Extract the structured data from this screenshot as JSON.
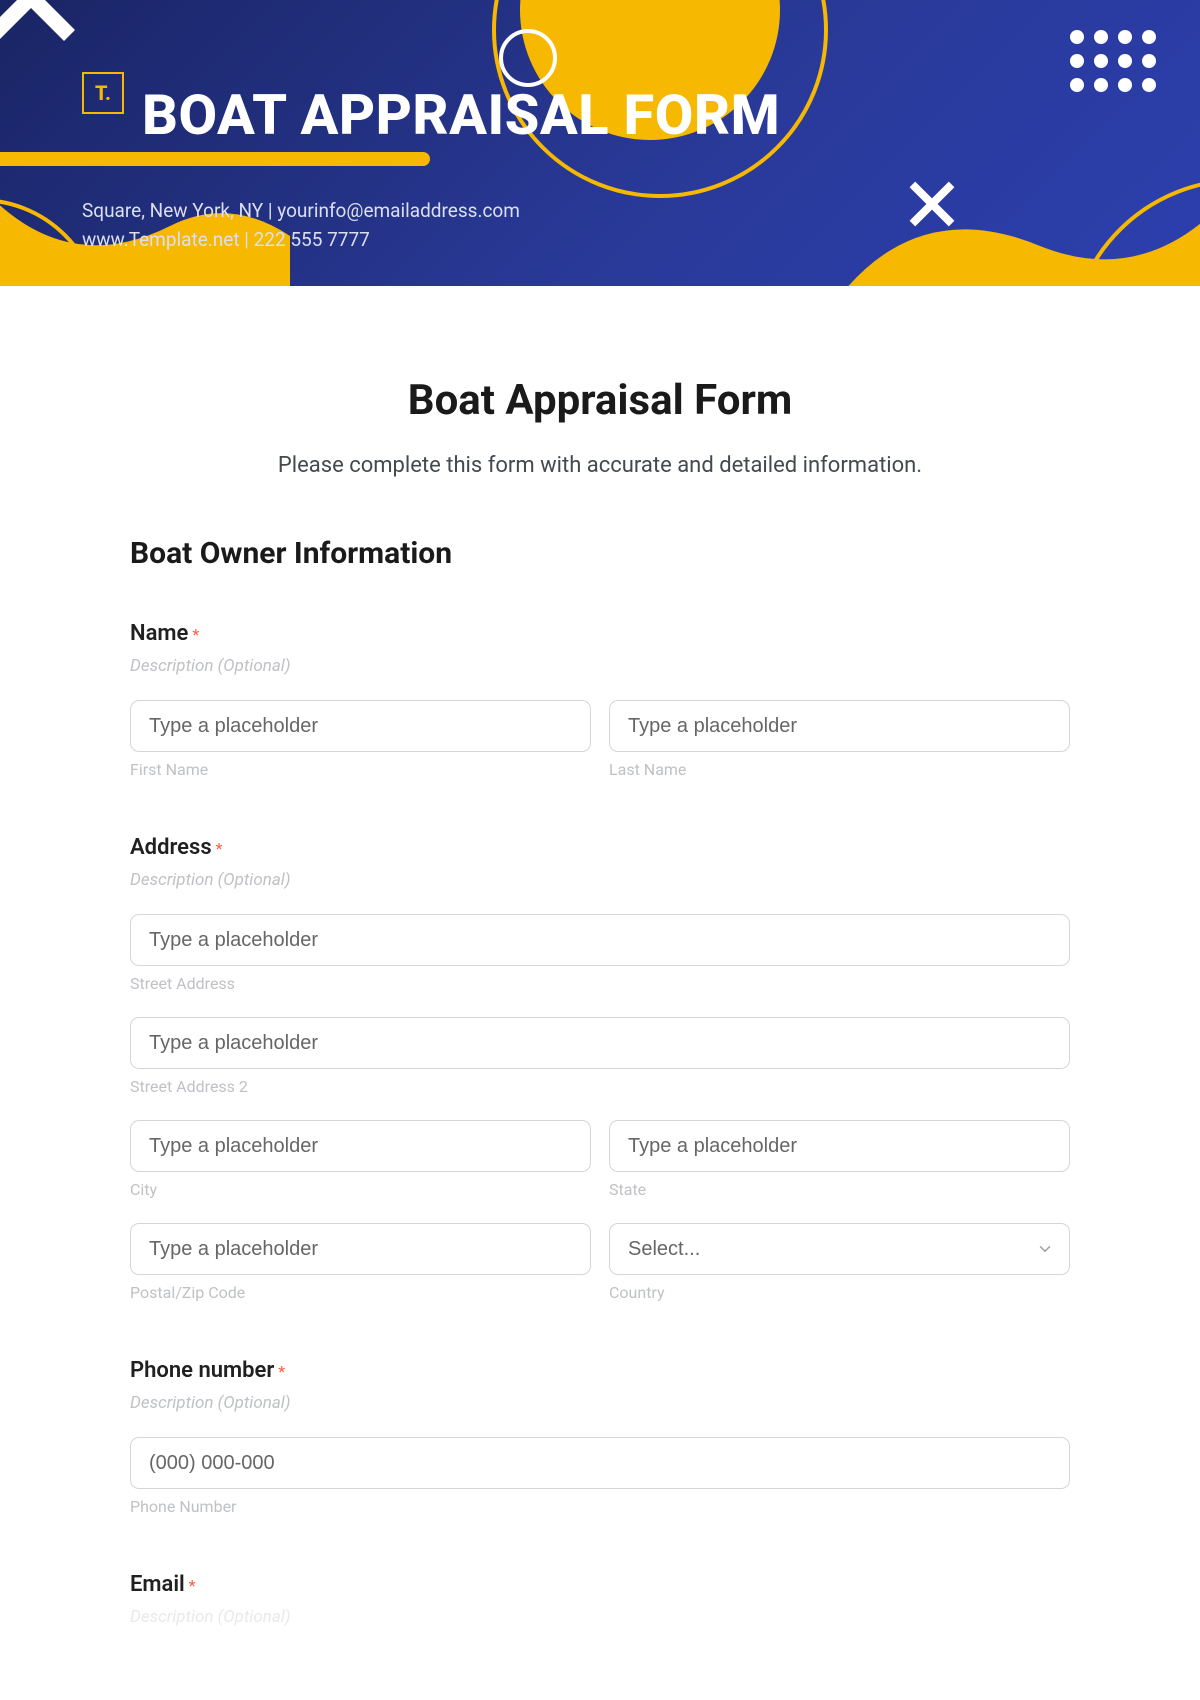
{
  "banner": {
    "logo_text": "T.",
    "title": "BOAT APPRAISAL FORM",
    "info_line1": "Square, New York, NY  |  yourinfo@emailaddress.com",
    "info_line2": "www.Template.net  |  222 555 7777"
  },
  "form": {
    "title": "Boat Appraisal Form",
    "subtitle": "Please complete this form with accurate and detailed information.",
    "section_title": "Boat Owner Information",
    "common": {
      "description_optional": "Description (Optional)",
      "placeholder": "Type a placeholder"
    },
    "name": {
      "label": "Name",
      "first_sub": "First Name",
      "last_sub": "Last Name"
    },
    "address": {
      "label": "Address",
      "street_sub": "Street Address",
      "street2_sub": "Street Address 2",
      "city_sub": "City",
      "state_sub": "State",
      "postal_sub": "Postal/Zip Code",
      "country_sub": "Country",
      "country_select_placeholder": "Select..."
    },
    "phone": {
      "label": "Phone number",
      "placeholder": "(000) 000-000",
      "sub": "Phone Number"
    },
    "email": {
      "label": "Email"
    }
  }
}
